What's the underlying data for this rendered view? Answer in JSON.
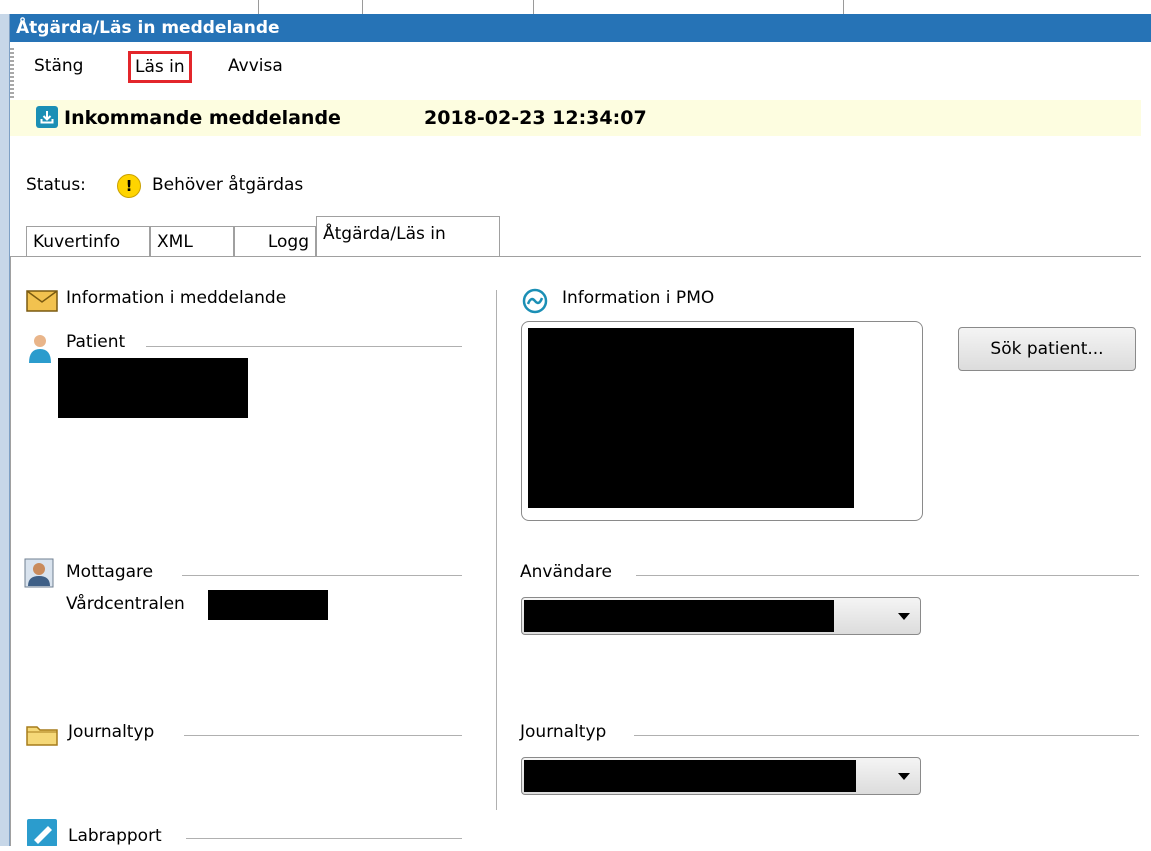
{
  "window": {
    "title": "Åtgärda/Läs in meddelande"
  },
  "toolbar": {
    "close_label": "Stäng",
    "read_in_label": "Läs in",
    "reject_label": "Avvisa"
  },
  "banner": {
    "title": "Inkommande meddelande",
    "timestamp": "2018-02-23 12:34:07"
  },
  "status": {
    "label": "Status:",
    "value": "Behöver åtgärdas",
    "icon": "warning-icon",
    "color": "#ffd400"
  },
  "tabs": [
    {
      "label": "Kuvertinfo"
    },
    {
      "label": "XML"
    },
    {
      "label": "Logg"
    },
    {
      "label": "Åtgärda/Läs in",
      "active": true
    }
  ],
  "left": {
    "heading": "Information i meddelande",
    "patient_label": "Patient",
    "recipient_label": "Mottagare",
    "recipient_value": "Vårdcentralen",
    "journal_label": "Journaltyp",
    "lab_label": "Labrapport"
  },
  "right": {
    "heading": "Information i PMO",
    "search_button": "Sök patient...",
    "user_label": "Användare",
    "journal_label": "Journaltyp"
  },
  "colors": {
    "titlebar": "#2673b6",
    "highlight": "#e3262b",
    "banner_bg": "#fdfde0"
  }
}
